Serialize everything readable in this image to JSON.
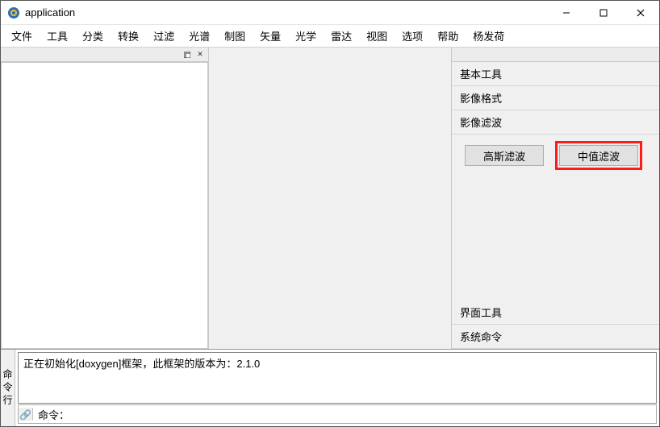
{
  "window": {
    "title": "application"
  },
  "menu": {
    "items": [
      "文件",
      "工具",
      "分类",
      "转换",
      "过滤",
      "光谱",
      "制图",
      "矢量",
      "光学",
      "雷达",
      "视图",
      "选项",
      "帮助",
      "杨发荷"
    ]
  },
  "rightpanel": {
    "sections": {
      "basic_tools": "基本工具",
      "image_format": "影像格式",
      "image_filter": "影像滤波",
      "ui_tools": "界面工具",
      "system_cmd": "系统命令"
    },
    "filter_buttons": {
      "gaussian": "高斯滤波",
      "median": "中值滤波"
    }
  },
  "console": {
    "vlabel": "命令行",
    "log_text": "正在初始化[doxygen]框架，此框架的版本为：2.1.0",
    "cmd_label": "命令：",
    "cmd_value": ""
  }
}
